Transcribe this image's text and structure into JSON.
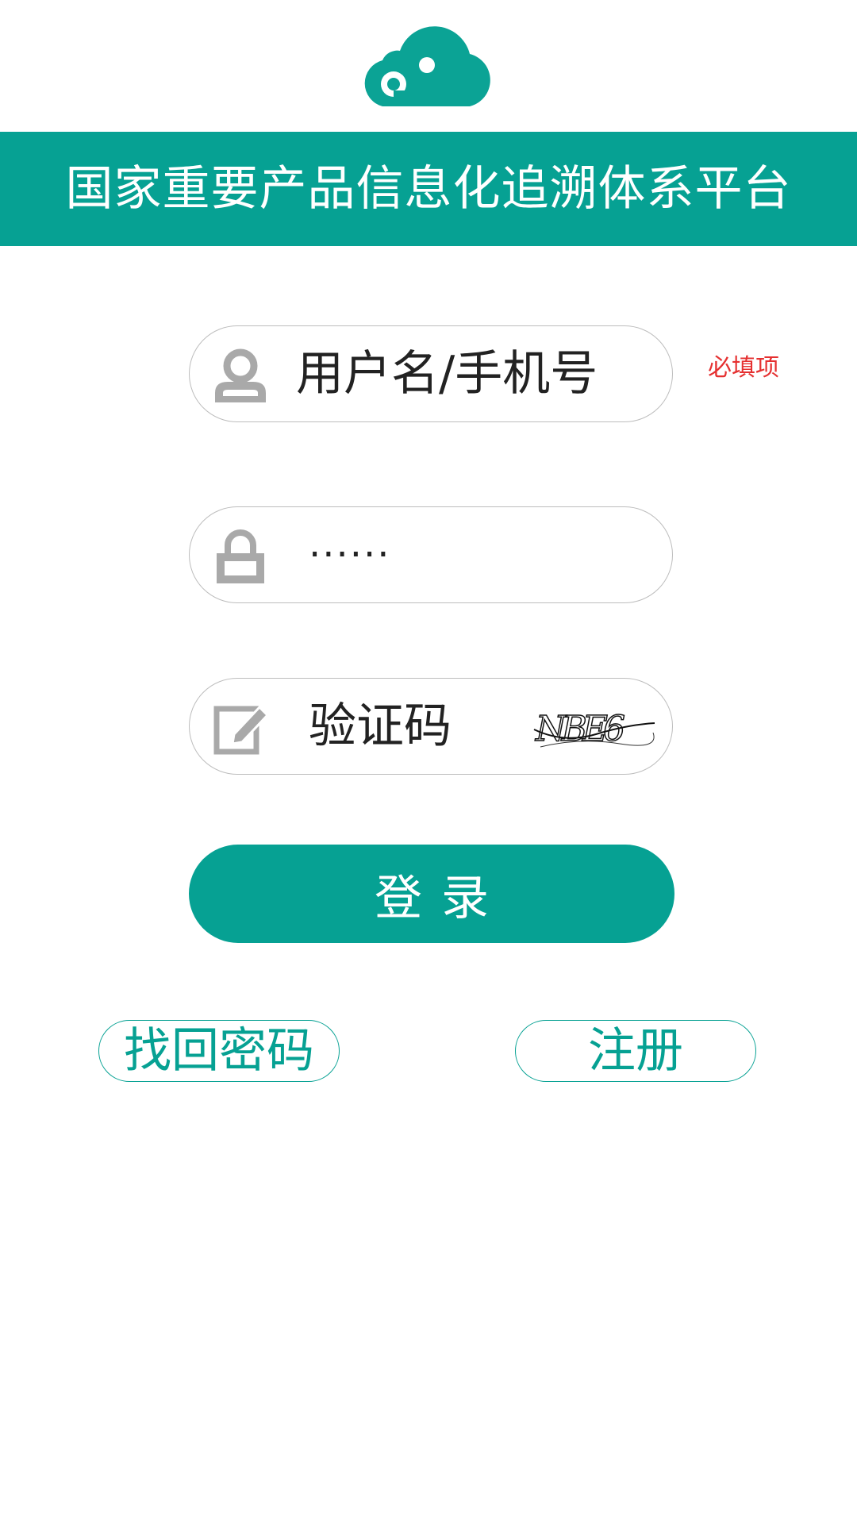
{
  "brand": {
    "logo_icon": "cloud-icon",
    "accent_color": "#06a193"
  },
  "header": {
    "title": "国家重要产品信息化追溯体系平台"
  },
  "form": {
    "username": {
      "icon": "user-icon",
      "placeholder": "用户名/手机号",
      "required_note": "必填项"
    },
    "password": {
      "icon": "lock-icon",
      "value": "······"
    },
    "captcha": {
      "icon": "edit-icon",
      "placeholder": "验证码",
      "captcha_text": "NBE6"
    },
    "login_label": "登录"
  },
  "links": {
    "forgot_password": "找回密码",
    "register": "注册"
  },
  "colors": {
    "required": "#e53030",
    "icon_gray": "#a9a9a9"
  }
}
